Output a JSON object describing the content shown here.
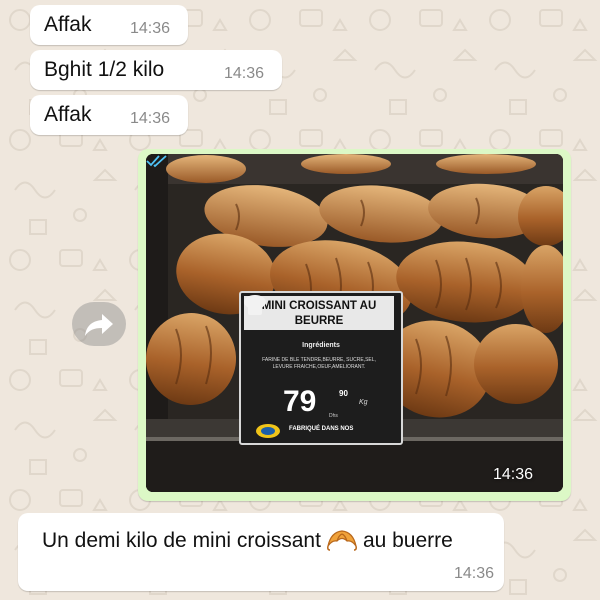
{
  "chat": {
    "messages": [
      {
        "direction": "incoming",
        "text": "Affak",
        "time": "14:36"
      },
      {
        "direction": "incoming",
        "text": "Bghit 1/2 kilo",
        "time": "14:36"
      },
      {
        "direction": "incoming",
        "text": "Affak",
        "time": "14:36"
      },
      {
        "direction": "outgoing",
        "type": "image",
        "time": "14:36",
        "status": "read",
        "image": {
          "tag_title": "MINI CROISSANT AU BEURRE",
          "tag_ingredients_title": "Ingrédients",
          "tag_ingredients": "FARINE DE BLE TENDRE,BEURRE, SUCRE,SEL, LEVURE FRAICHE,OEUF,AMELIORANT.",
          "tag_price": "79",
          "tag_cents": "90",
          "tag_unit": "Kg",
          "tag_currency": "Dhs",
          "tag_footer": "FABRIQUÉ DANS NOS"
        }
      },
      {
        "direction": "incoming",
        "text_before": "Un demi kilo de mini croissant",
        "emoji": "croissant",
        "text_after": "au buerre",
        "time": "14:36"
      }
    ]
  },
  "colors": {
    "wallpaper": "#efe7dd",
    "outgoing": "#dcf8c6",
    "incoming": "#ffffff",
    "read_ticks": "#4fc3f7"
  },
  "icons": {
    "forward": "forward-arrow-icon",
    "status": "double-check-icon"
  }
}
